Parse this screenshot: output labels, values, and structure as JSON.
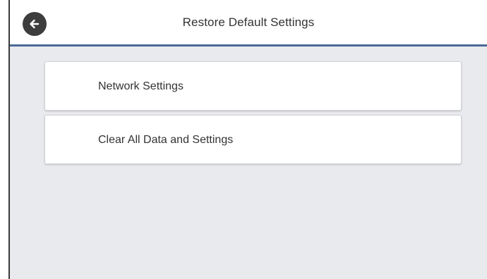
{
  "header": {
    "title": "Restore Default Settings",
    "back_icon": "back-arrow-icon"
  },
  "menu": {
    "items": [
      {
        "label": "Network Settings"
      },
      {
        "label": "Clear All Data and Settings"
      }
    ]
  },
  "colors": {
    "background": "#e9eaee",
    "header_bg": "#ffffff",
    "header_rule": "#4a6a96",
    "back_button": "#3d3d3d",
    "text": "#333333"
  }
}
